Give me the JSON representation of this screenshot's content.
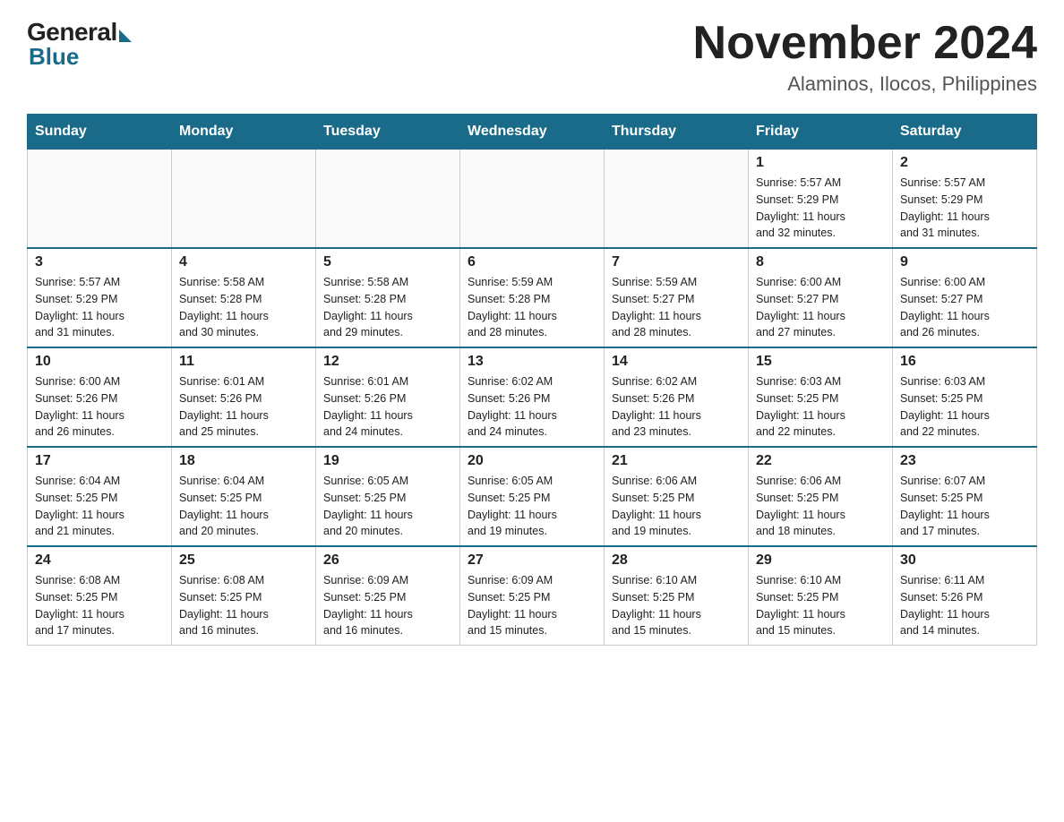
{
  "header": {
    "logo": {
      "general": "General",
      "blue": "Blue"
    },
    "title": "November 2024",
    "location": "Alaminos, Ilocos, Philippines"
  },
  "calendar": {
    "days_of_week": [
      "Sunday",
      "Monday",
      "Tuesday",
      "Wednesday",
      "Thursday",
      "Friday",
      "Saturday"
    ],
    "weeks": [
      [
        {
          "day": "",
          "info": ""
        },
        {
          "day": "",
          "info": ""
        },
        {
          "day": "",
          "info": ""
        },
        {
          "day": "",
          "info": ""
        },
        {
          "day": "",
          "info": ""
        },
        {
          "day": "1",
          "info": "Sunrise: 5:57 AM\nSunset: 5:29 PM\nDaylight: 11 hours\nand 32 minutes."
        },
        {
          "day": "2",
          "info": "Sunrise: 5:57 AM\nSunset: 5:29 PM\nDaylight: 11 hours\nand 31 minutes."
        }
      ],
      [
        {
          "day": "3",
          "info": "Sunrise: 5:57 AM\nSunset: 5:29 PM\nDaylight: 11 hours\nand 31 minutes."
        },
        {
          "day": "4",
          "info": "Sunrise: 5:58 AM\nSunset: 5:28 PM\nDaylight: 11 hours\nand 30 minutes."
        },
        {
          "day": "5",
          "info": "Sunrise: 5:58 AM\nSunset: 5:28 PM\nDaylight: 11 hours\nand 29 minutes."
        },
        {
          "day": "6",
          "info": "Sunrise: 5:59 AM\nSunset: 5:28 PM\nDaylight: 11 hours\nand 28 minutes."
        },
        {
          "day": "7",
          "info": "Sunrise: 5:59 AM\nSunset: 5:27 PM\nDaylight: 11 hours\nand 28 minutes."
        },
        {
          "day": "8",
          "info": "Sunrise: 6:00 AM\nSunset: 5:27 PM\nDaylight: 11 hours\nand 27 minutes."
        },
        {
          "day": "9",
          "info": "Sunrise: 6:00 AM\nSunset: 5:27 PM\nDaylight: 11 hours\nand 26 minutes."
        }
      ],
      [
        {
          "day": "10",
          "info": "Sunrise: 6:00 AM\nSunset: 5:26 PM\nDaylight: 11 hours\nand 26 minutes."
        },
        {
          "day": "11",
          "info": "Sunrise: 6:01 AM\nSunset: 5:26 PM\nDaylight: 11 hours\nand 25 minutes."
        },
        {
          "day": "12",
          "info": "Sunrise: 6:01 AM\nSunset: 5:26 PM\nDaylight: 11 hours\nand 24 minutes."
        },
        {
          "day": "13",
          "info": "Sunrise: 6:02 AM\nSunset: 5:26 PM\nDaylight: 11 hours\nand 24 minutes."
        },
        {
          "day": "14",
          "info": "Sunrise: 6:02 AM\nSunset: 5:26 PM\nDaylight: 11 hours\nand 23 minutes."
        },
        {
          "day": "15",
          "info": "Sunrise: 6:03 AM\nSunset: 5:25 PM\nDaylight: 11 hours\nand 22 minutes."
        },
        {
          "day": "16",
          "info": "Sunrise: 6:03 AM\nSunset: 5:25 PM\nDaylight: 11 hours\nand 22 minutes."
        }
      ],
      [
        {
          "day": "17",
          "info": "Sunrise: 6:04 AM\nSunset: 5:25 PM\nDaylight: 11 hours\nand 21 minutes."
        },
        {
          "day": "18",
          "info": "Sunrise: 6:04 AM\nSunset: 5:25 PM\nDaylight: 11 hours\nand 20 minutes."
        },
        {
          "day": "19",
          "info": "Sunrise: 6:05 AM\nSunset: 5:25 PM\nDaylight: 11 hours\nand 20 minutes."
        },
        {
          "day": "20",
          "info": "Sunrise: 6:05 AM\nSunset: 5:25 PM\nDaylight: 11 hours\nand 19 minutes."
        },
        {
          "day": "21",
          "info": "Sunrise: 6:06 AM\nSunset: 5:25 PM\nDaylight: 11 hours\nand 19 minutes."
        },
        {
          "day": "22",
          "info": "Sunrise: 6:06 AM\nSunset: 5:25 PM\nDaylight: 11 hours\nand 18 minutes."
        },
        {
          "day": "23",
          "info": "Sunrise: 6:07 AM\nSunset: 5:25 PM\nDaylight: 11 hours\nand 17 minutes."
        }
      ],
      [
        {
          "day": "24",
          "info": "Sunrise: 6:08 AM\nSunset: 5:25 PM\nDaylight: 11 hours\nand 17 minutes."
        },
        {
          "day": "25",
          "info": "Sunrise: 6:08 AM\nSunset: 5:25 PM\nDaylight: 11 hours\nand 16 minutes."
        },
        {
          "day": "26",
          "info": "Sunrise: 6:09 AM\nSunset: 5:25 PM\nDaylight: 11 hours\nand 16 minutes."
        },
        {
          "day": "27",
          "info": "Sunrise: 6:09 AM\nSunset: 5:25 PM\nDaylight: 11 hours\nand 15 minutes."
        },
        {
          "day": "28",
          "info": "Sunrise: 6:10 AM\nSunset: 5:25 PM\nDaylight: 11 hours\nand 15 minutes."
        },
        {
          "day": "29",
          "info": "Sunrise: 6:10 AM\nSunset: 5:25 PM\nDaylight: 11 hours\nand 15 minutes."
        },
        {
          "day": "30",
          "info": "Sunrise: 6:11 AM\nSunset: 5:26 PM\nDaylight: 11 hours\nand 14 minutes."
        }
      ]
    ]
  }
}
